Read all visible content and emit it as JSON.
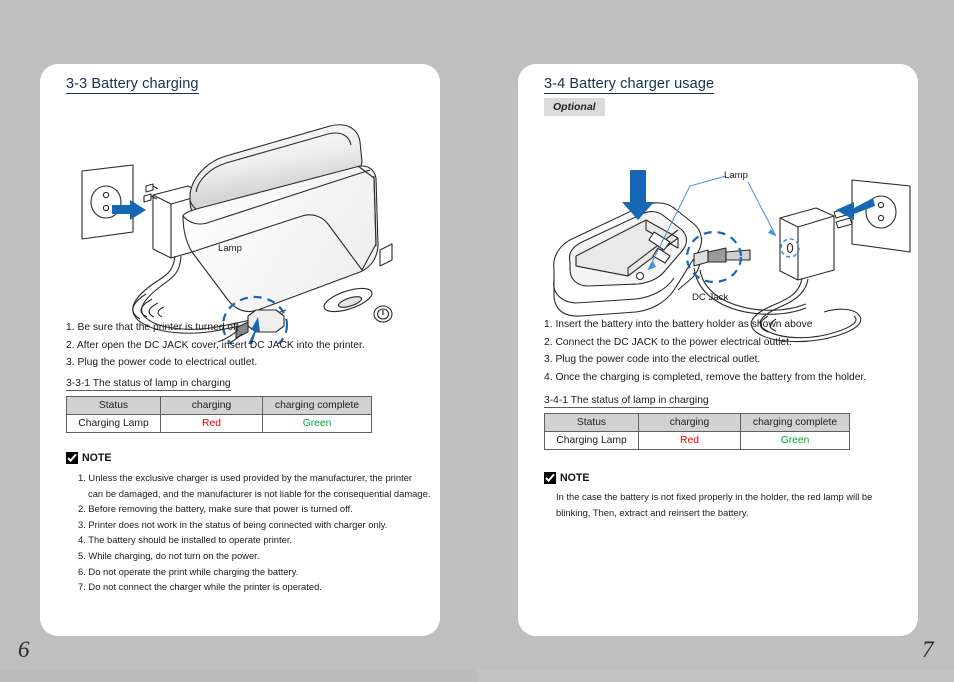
{
  "document": {
    "background_color": "#bfbfbf",
    "page_color": "#ffffff"
  },
  "left_page": {
    "page_number": "6",
    "section_title": "3-3 Battery charging",
    "illustration": {
      "labels": {
        "lamp": "Lamp"
      },
      "alt": "Wall outlet with AC adapter plugged in, coiled cable running to a mobile thermal printer; dashed blue circle highlights the DC jack"
    },
    "steps": [
      "1. Be sure that the printer is turned off",
      "2. After open the DC JACK cover, insert DC JACK into the printer.",
      "3. Plug the power code to electrical outlet."
    ],
    "sub_title": "3-3-1 The status of lamp in charging",
    "table": {
      "headers": [
        "Status",
        "charging",
        "charging complete"
      ],
      "row": {
        "label": "Charging Lamp",
        "charging": "Red",
        "charging_complete": "Green",
        "charging_color": "#e60000",
        "complete_color": "#00a53a"
      }
    },
    "note": {
      "title": "NOTE",
      "items": [
        "1. Unless the exclusive charger is used provided by the manufacturer, the printer",
        "can be damaged, and the manufacturer is not liable for the consequential damage.",
        "2. Before removing the battery, make sure that power is turned off.",
        "3. Printer does not work in the status of being connected with charger only.",
        "4. The battery should be installed to operate printer.",
        "5. While charging, do not turn on the power.",
        "6. Do not operate the print while charging the battery.",
        "7. Do not connect the charger while the printer is operated."
      ]
    }
  },
  "right_page": {
    "page_number": "7",
    "section_title": "3-4 Battery charger usage",
    "optional_badge": "Optional",
    "illustration": {
      "labels": {
        "lamp": "Lamp",
        "dc_jack": "DC Jack"
      },
      "alt": "Battery charging cradle with a battery being inserted from above, AC adapter plugged into a wall outlet, DC jack connecting to the cradle"
    },
    "steps": [
      "1. Insert the battery into the battery holder as shown above",
      "2. Connect the DC JACK to the power electrical outlet.",
      "3. Plug the power code into the electrical outlet.",
      "4. Once the charging is completed, remove the battery from the holder."
    ],
    "sub_title": "3-4-1 The status of lamp in charging",
    "table": {
      "headers": [
        "Status",
        "charging",
        "charging complete"
      ],
      "row": {
        "label": "Charging Lamp",
        "charging": "Red",
        "charging_complete": "Green",
        "charging_color": "#e60000",
        "complete_color": "#00a53a"
      }
    },
    "note": {
      "title": "NOTE",
      "items": [
        "In the case the battery is not fixed properly in the holder, the red lamp will be",
        "blinking, Then, extract and reinsert the battery."
      ]
    }
  }
}
